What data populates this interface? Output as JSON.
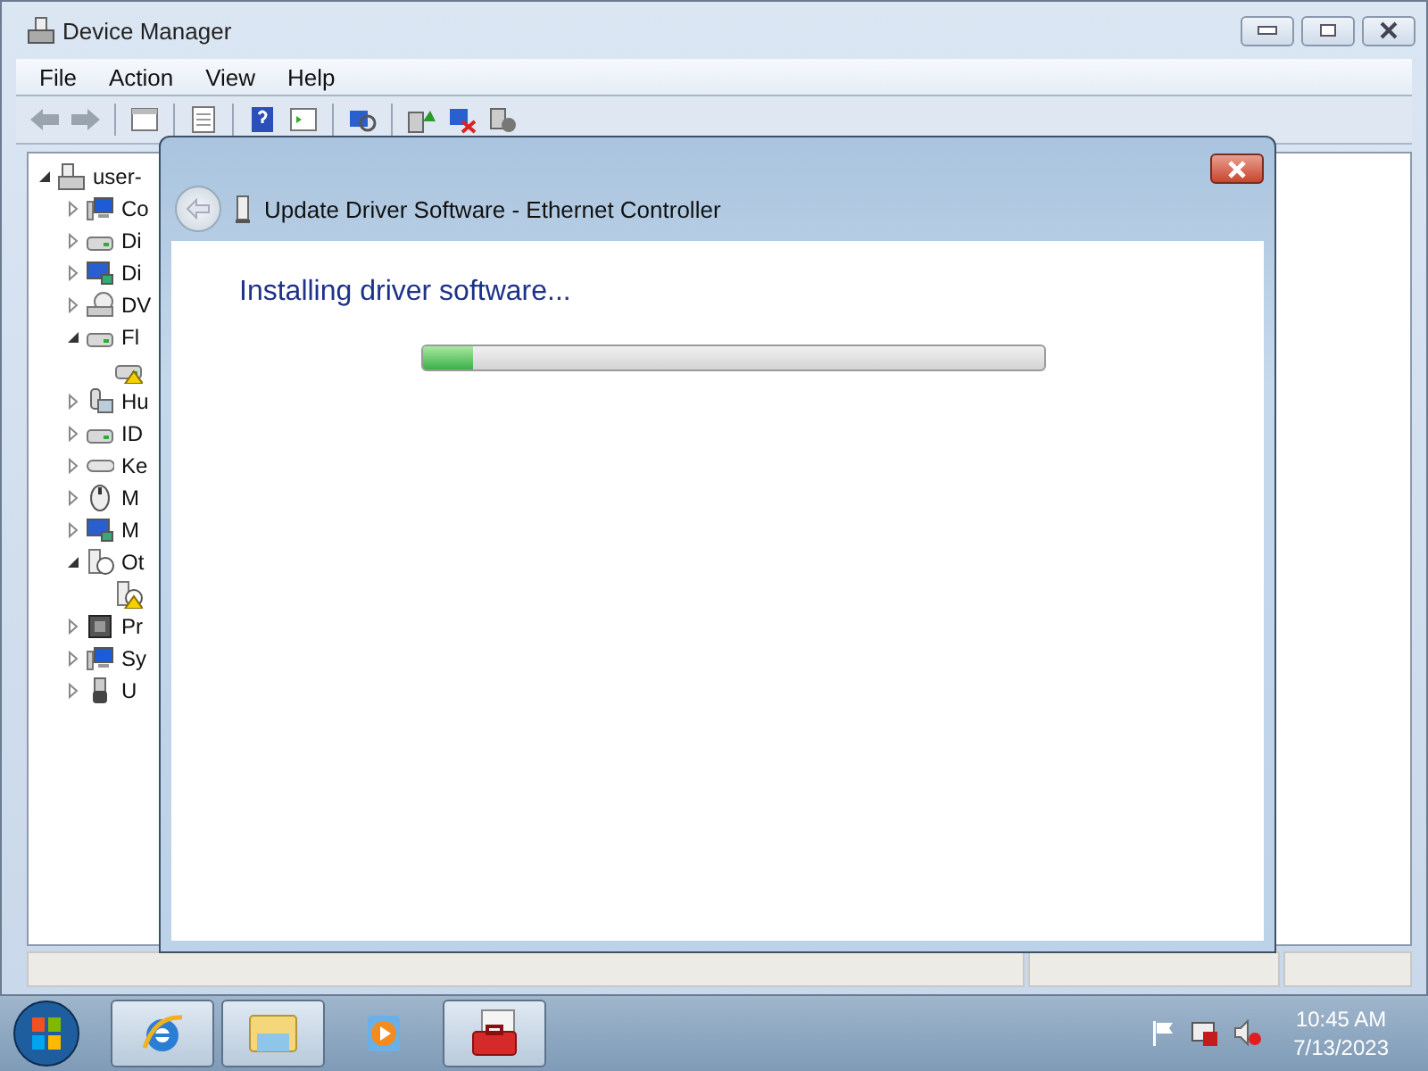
{
  "window": {
    "title": "Device Manager"
  },
  "menu": [
    "File",
    "Action",
    "View",
    "Help"
  ],
  "tree": {
    "label": "user-",
    "expanded": true,
    "children": [
      {
        "label": "Co",
        "kind": "computer",
        "expanded": false
      },
      {
        "label": "Di",
        "kind": "drive",
        "expanded": false
      },
      {
        "label": "Di",
        "kind": "display",
        "expanded": false
      },
      {
        "label": "DV",
        "kind": "disc",
        "expanded": false
      },
      {
        "label": "Fl",
        "kind": "drive",
        "expanded": true,
        "children": [
          {
            "kind": "drive",
            "warning": true
          }
        ]
      },
      {
        "label": "Hu",
        "kind": "hid",
        "expanded": false
      },
      {
        "label": "ID",
        "kind": "drive",
        "expanded": false
      },
      {
        "label": "Ke",
        "kind": "keyboard",
        "expanded": false
      },
      {
        "label": "M",
        "kind": "mouse",
        "expanded": false
      },
      {
        "label": "M",
        "kind": "display",
        "expanded": false
      },
      {
        "label": "Ot",
        "kind": "unknown",
        "expanded": true,
        "children": [
          {
            "kind": "unknown",
            "warning": true
          }
        ]
      },
      {
        "label": "Pr",
        "kind": "chip",
        "expanded": false
      },
      {
        "label": "Sy",
        "kind": "computer",
        "expanded": false
      },
      {
        "label": "U",
        "kind": "usb",
        "expanded": false
      }
    ]
  },
  "dialog": {
    "title": "Update Driver Software - Ethernet Controller",
    "heading": "Installing driver software...",
    "progress": {
      "level": 0.08
    }
  },
  "taskbar": {
    "apps": [
      {
        "kind": "browser",
        "running": true
      },
      {
        "kind": "folder",
        "running": true
      },
      {
        "kind": "player",
        "running": false
      },
      {
        "kind": "toolbox",
        "running": true
      }
    ],
    "time": "10:45 AM",
    "date": "7/13/2023"
  }
}
